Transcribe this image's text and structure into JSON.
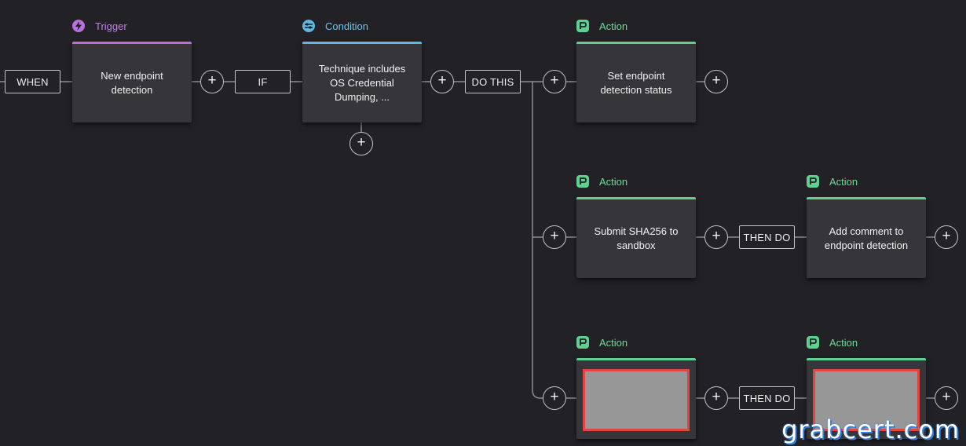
{
  "workflow": {
    "when_label": "WHEN",
    "if_label": "IF",
    "do_this_label": "DO THIS",
    "then_do_label": "THEN DO",
    "plus_symbol": "+",
    "trigger": {
      "header": "Trigger",
      "text": "New endpoint\ndetection"
    },
    "condition": {
      "header": "Condition",
      "text": "Technique includes\nOS Credential\nDumping, ..."
    },
    "actions": [
      {
        "header": "Action",
        "text": "Set endpoint\ndetection status"
      },
      {
        "header": "Action",
        "text": "Submit SHA256 to\nsandbox"
      },
      {
        "header": "Action",
        "text": "Add comment to\nendpoint detection"
      },
      {
        "header": "Action",
        "text": ""
      },
      {
        "header": "Action",
        "text": ""
      }
    ]
  },
  "icons": {
    "trigger": "lightning-bolt-icon",
    "condition": "condition-icon",
    "action": "action-icon"
  },
  "colors": {
    "background": "#222126",
    "trigger_accent": "#b86fe0",
    "condition_accent": "#5fb8e0",
    "action_accent": "#5fd08f",
    "redaction_border": "#e1453d",
    "redaction_fill": "#979797"
  },
  "watermark": "grabcert.com"
}
